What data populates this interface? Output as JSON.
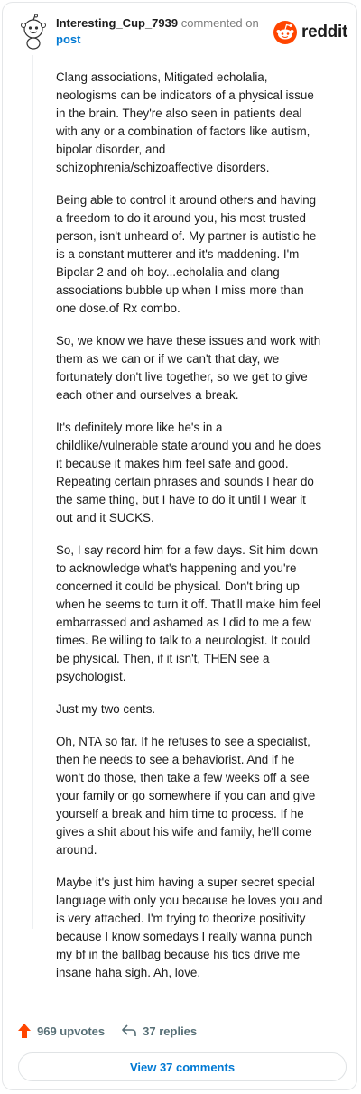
{
  "header": {
    "username": "Interesting_Cup_7939",
    "action_text": "commented on",
    "post_link": "post",
    "brand": "reddit"
  },
  "comment": {
    "paragraphs": [
      "Clang associations, Mitigated echolalia,\nneologisms can be indicators of a physical issue\nin the brain. They're also seen in patients deal\nwith any or a combination of factors like autism,\nbipolar disorder, and\nschizophrenia/schizoaffective disorders.",
      "Being able to control it around others and having\na freedom to do it around you, his most trusted\nperson, isn't unheard of. My partner is autistic he\nis a constant mutterer and it's maddening. I'm\nBipolar 2 and oh boy...echolalia and clang\nassociations bubble up when I miss more than\none dose.of Rx combo.",
      "So, we know we have these issues and work with\nthem as we can or if we can't that day, we\nfortunately don't live together, so we get to give\neach other and ourselves a break.",
      "It's definitely more like he's in a\nchildlike/vulnerable state around you and he does\nit because it makes him feel safe and good.\nRepeating certain phrases and sounds I hear do\nthe same thing, but I have to do it until I wear it\nout and it SUCKS.",
      "So, I say record him for a few days. Sit him down\nto acknowledge what's happening and you're\nconcerned it could be physical. Don't bring up\nwhen he seems to turn it off. That'll make him feel\nembarrassed and ashamed as I did to me a few\ntimes. Be willing to talk to a neurologist. It could\nbe physical. Then, if it isn't, THEN see a\npsychologist.",
      "Just my two cents.",
      "Oh, NTA so far. If he refuses to see a specialist,\nthen he needs to see a behaviorist. And if he\nwon't do those, then take a few weeks off a see\nyour family or go somewhere if you can and give\nyourself a break and him time to process. If he\ngives a shit about his wife and family, he'll come\naround.",
      "Maybe it's just him having a super secret special\nlanguage with only you because he loves you and\nis very attached. I'm trying to theorize positivity\nbecause I know somedays I really wanna punch\nmy bf in the ballbag because his tics drive me\ninsane haha sigh. Ah, love."
    ]
  },
  "actions": {
    "upvotes": "969 upvotes",
    "replies": "37 replies"
  },
  "footer": {
    "view_comments": "View 37 comments"
  },
  "colors": {
    "upvote": "#ff4500",
    "link": "#0079d3",
    "brand": "#ff4500"
  },
  "icons": {
    "avatar": "snoo-avatar-icon",
    "logo": "reddit-logo-icon",
    "upvote": "upvote-arrow-icon",
    "reply": "reply-arrow-icon"
  }
}
